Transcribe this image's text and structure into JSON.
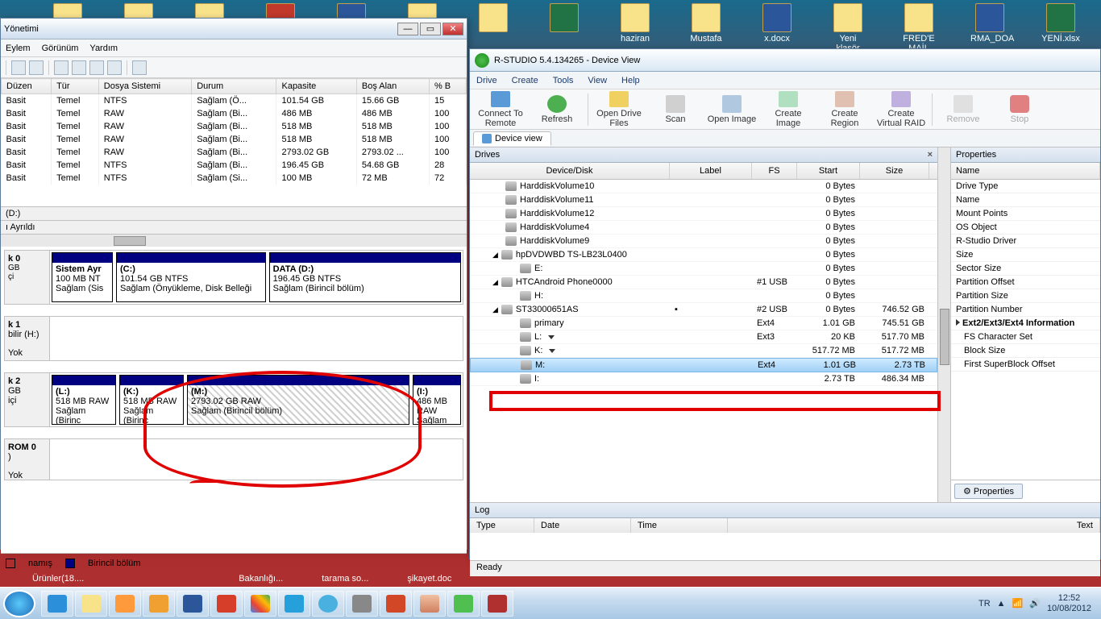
{
  "desktop": {
    "icons": [
      "",
      "",
      "",
      "",
      "",
      "",
      "haziran",
      "Mustafa",
      "x.docx",
      "Yeni klasör",
      "FRED'E MAİL",
      "",
      "RMA_DOA ...",
      "YENİ.xlsx"
    ]
  },
  "dm": {
    "title": "Yönetimi",
    "menu": [
      "Eylem",
      "Görünüm",
      "Yardım"
    ],
    "cols": [
      "Düzen",
      "Tür",
      "Dosya Sistemi",
      "Durum",
      "Kapasite",
      "Boş Alan",
      "% B"
    ],
    "rows": [
      {
        "d": "Basit",
        "t": "Temel",
        "fs": "NTFS",
        "s": "Sağlam (Ö...",
        "c": "101.54 GB",
        "f": "15.66 GB",
        "p": "15"
      },
      {
        "d": "Basit",
        "t": "Temel",
        "fs": "RAW",
        "s": "Sağlam (Bi...",
        "c": "486 MB",
        "f": "486 MB",
        "p": "100"
      },
      {
        "d": "Basit",
        "t": "Temel",
        "fs": "RAW",
        "s": "Sağlam (Bi...",
        "c": "518 MB",
        "f": "518 MB",
        "p": "100"
      },
      {
        "d": "Basit",
        "t": "Temel",
        "fs": "RAW",
        "s": "Sağlam (Bi...",
        "c": "518 MB",
        "f": "518 MB",
        "p": "100"
      },
      {
        "d": "Basit",
        "t": "Temel",
        "fs": "RAW",
        "s": "Sağlam (Bi...",
        "c": "2793.02 GB",
        "f": "2793.02 ...",
        "p": "100"
      },
      {
        "d": "Basit",
        "t": "Temel",
        "fs": "NTFS",
        "s": "Sağlam (Bi...",
        "c": "196.45 GB",
        "f": "54.68 GB",
        "p": "28"
      },
      {
        "d": "Basit",
        "t": "Temel",
        "fs": "NTFS",
        "s": "Sağlam (Si...",
        "c": "100 MB",
        "f": "72 MB",
        "p": "72"
      }
    ],
    "ayrildi_label": "(D:)",
    "ayrildi": "ı Ayrıldı",
    "disk0": {
      "hdr": "k 0",
      "vol1": {
        "t": "Sistem Ayr",
        "c": "100 MB NT",
        "s": "Sağlam (Sis"
      },
      "vol2": {
        "t": "(C:)",
        "c": "101.54 GB NTFS",
        "s": "Sağlam (Önyükleme, Disk Belleği"
      },
      "vol3": {
        "t": "DATA  (D:)",
        "c": "196.45 GB NTFS",
        "s": "Sağlam (Birincil bölüm)"
      }
    },
    "disk1": {
      "hdr": "k 1",
      "sub": "bilir (H:)",
      "yok": "Yok"
    },
    "disk2": {
      "hdr": "k 2",
      "sub": "GB",
      "sub2": "içi",
      "v1": {
        "t": "(L:)",
        "c": "518 MB RAW",
        "s": "Sağlam (Birinc"
      },
      "v2": {
        "t": "(K:)",
        "c": "518 MB RAW",
        "s": "Sağlam (Birinc"
      },
      "v3": {
        "t": "(M:)",
        "c": "2793.02 GB RAW",
        "s": "Sağlam (Birincil bölüm)"
      },
      "v4": {
        "t": "(I:)",
        "c": "486 MB RAW",
        "s": "Sağlam (Birinc"
      }
    },
    "rom": {
      "hdr": "ROM 0",
      "sub": ")",
      "yok": "Yok"
    },
    "legend": {
      "a": "namış",
      "b": "Birincil bölüm"
    }
  },
  "rs": {
    "title": "R-STUDIO 5.4.134265 - Device View",
    "menu": [
      "Drive",
      "Create",
      "Tools",
      "View",
      "Help"
    ],
    "toolbar": [
      "Connect To Remote",
      "Refresh",
      "Open Drive Files",
      "Scan",
      "Open Image",
      "Create Image",
      "Create Region",
      "Create Virtual RAID",
      "Remove",
      "Stop"
    ],
    "tab": "Device view",
    "drives_title": "Drives",
    "cols": [
      "Device/Disk",
      "Label",
      "FS",
      "Start",
      "Size"
    ],
    "rows": [
      {
        "i": 34,
        "n": "HarddiskVolume10",
        "l": "",
        "fs": "",
        "st": "0 Bytes",
        "sz": ""
      },
      {
        "i": 34,
        "n": "HarddiskVolume11",
        "l": "",
        "fs": "",
        "st": "0 Bytes",
        "sz": ""
      },
      {
        "i": 34,
        "n": "HarddiskVolume12",
        "l": "",
        "fs": "",
        "st": "0 Bytes",
        "sz": ""
      },
      {
        "i": 34,
        "n": "HarddiskVolume4",
        "l": "",
        "fs": "",
        "st": "0 Bytes",
        "sz": ""
      },
      {
        "i": 34,
        "n": "HarddiskVolume9",
        "l": "",
        "fs": "",
        "st": "0 Bytes",
        "sz": ""
      },
      {
        "i": 18,
        "n": "hpDVDWBD TS-LB23L0400",
        "l": "",
        "fs": "",
        "st": "0 Bytes",
        "sz": "",
        "exp": true
      },
      {
        "i": 52,
        "n": "E:",
        "l": "",
        "fs": "",
        "st": "0 Bytes",
        "sz": ""
      },
      {
        "i": 18,
        "n": "HTCAndroid Phone0000",
        "l": "",
        "fs": "#1 USB",
        "st": "0 Bytes",
        "sz": "",
        "exp": true
      },
      {
        "i": 52,
        "n": "H:",
        "l": "",
        "fs": "",
        "st": "0 Bytes",
        "sz": ""
      },
      {
        "i": 18,
        "n": "ST33000651AS",
        "l": "▪",
        "fs": "#2 USB",
        "st": "0 Bytes",
        "sz": "746.52 GB",
        "exp": true
      },
      {
        "i": 52,
        "n": "primary",
        "l": "",
        "fs": "Ext4",
        "st": "1.01 GB",
        "sz": "745.51 GB"
      },
      {
        "i": 52,
        "n": "L:",
        "l": "",
        "fs": "Ext3",
        "st": "20 KB",
        "sz": "517.70 MB",
        "dd": true
      },
      {
        "i": 52,
        "n": "K:",
        "l": "",
        "fs": "",
        "st": "517.72 MB",
        "sz": "517.72 MB",
        "dd": true
      },
      {
        "i": 52,
        "n": "M:",
        "l": "",
        "fs": "Ext4",
        "st": "1.01 GB",
        "sz": "2.73 TB",
        "sel": true
      },
      {
        "i": 52,
        "n": "I:",
        "l": "",
        "fs": "",
        "st": "2.73 TB",
        "sz": "486.34 MB"
      }
    ],
    "props_title": "Properties",
    "props_name": "Name",
    "props": [
      "Drive Type",
      "Name",
      "Mount Points",
      "OS Object",
      "R-Studio Driver",
      "Size",
      "Sector Size",
      "Partition Offset",
      "Partition Size",
      "Partition Number"
    ],
    "props_section": "Ext2/Ext3/Ext4 Information",
    "props2": [
      "FS Character Set",
      "Block Size",
      "First SuperBlock Offset"
    ],
    "props_btn": "Properties",
    "log": "Log",
    "log_cols": [
      "Type",
      "Date",
      "Time",
      "Text"
    ],
    "status": "Ready"
  },
  "taskbar": {
    "labels": [
      "Ürünler(18....",
      "",
      "",
      "",
      "",
      "Bakanlığı...",
      "tarama so...",
      "şikayet.doc"
    ],
    "lang": "TR",
    "time": "12:52",
    "date": "10/08/2012"
  }
}
